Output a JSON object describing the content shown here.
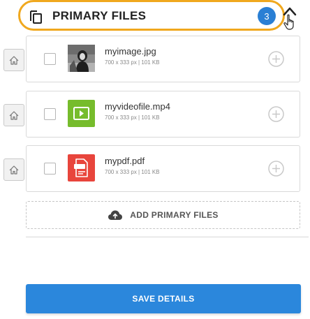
{
  "header": {
    "title": "PRIMARY FILES",
    "count": "3",
    "icon": "copy-icon",
    "toggle_icon": "chevron-up-icon",
    "accent_color": "#f0a81e",
    "badge_color": "#2a7fd4"
  },
  "files": [
    {
      "name": "myimage.jpg",
      "meta": "700 x 333 px | 101 KB",
      "type": "image",
      "icon": "image-thumbnail"
    },
    {
      "name": "myvideofile.mp4",
      "meta": "700 x 333 px | 101 KB",
      "type": "video",
      "icon": "video-icon",
      "color": "#76bc2c"
    },
    {
      "name": "mypdf.pdf",
      "meta": "700 x 333 px | 101 KB",
      "type": "pdf",
      "icon": "pdf-icon",
      "color": "#e8453c"
    }
  ],
  "add_files": {
    "label": "ADD PRIMARY FILES",
    "icon": "cloud-upload-icon"
  },
  "save": {
    "label": "SAVE DETAILS",
    "color": "#2b87dc"
  }
}
